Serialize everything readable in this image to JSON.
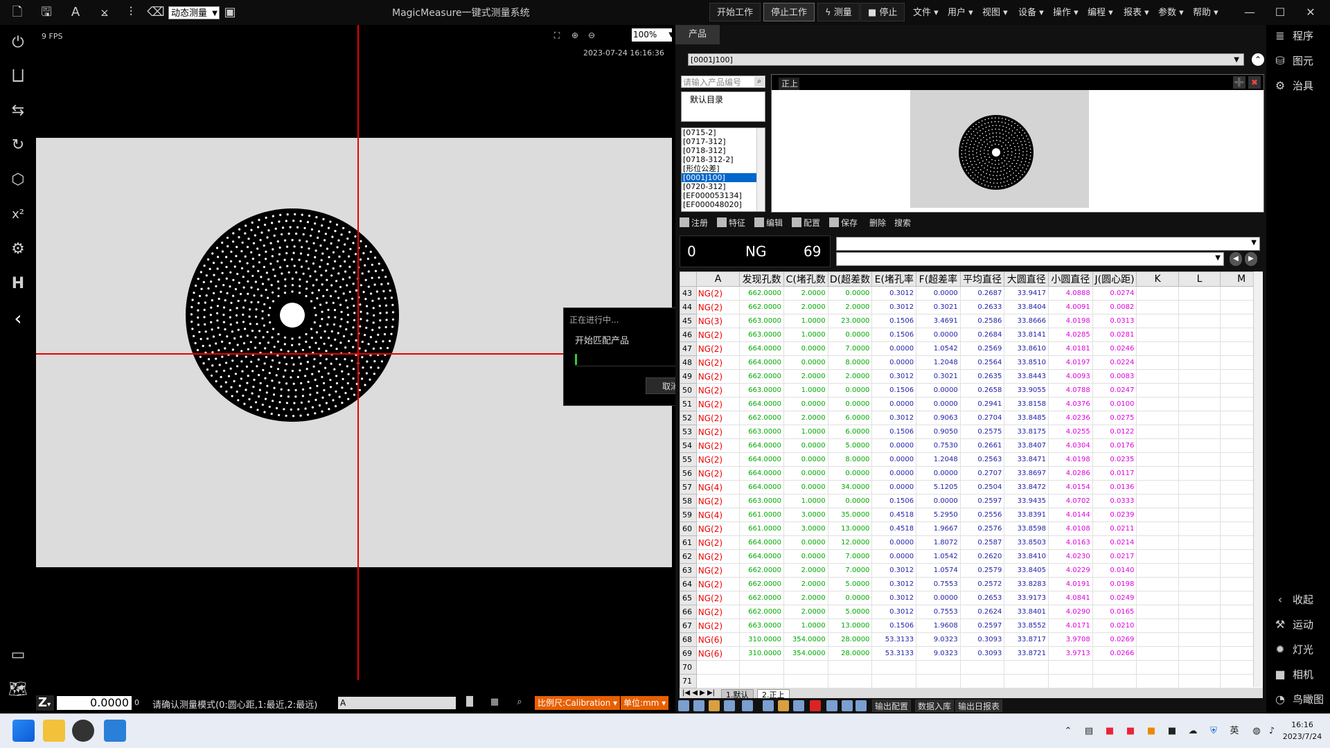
{
  "window": {
    "title": "MagicMeasure一键式测量系统",
    "mode_select": "动态测量"
  },
  "run_buttons": {
    "start": "开始工作",
    "stop_work": "停止工作",
    "measure": "测量",
    "stop": "停止"
  },
  "menu": [
    "文件",
    "用户",
    "视图",
    "设备",
    "操作",
    "编程",
    "报表",
    "参数",
    "帮助"
  ],
  "camera": {
    "fps": "9 FPS",
    "timestamp": "2023-07-24 16:16:36",
    "zoom": "100%"
  },
  "progress_dialog": {
    "title": "正在进行中...",
    "message": "开始匹配产品",
    "cancel": "取消",
    "progress": 0.01
  },
  "statusbar": {
    "z_label": "Z",
    "z_value": "0.0000",
    "z_suffix": "0",
    "prompt": "请确认测量模式(0:圆心距,1:最近,2:最远)",
    "prompt_value": "A",
    "calibration": "比例尺:Calibration",
    "unit": "单位:mm"
  },
  "product": {
    "tab": "产品",
    "selected": "[0001J100]",
    "search_placeholder": "请输入产品编号",
    "default_dir": "默认目录",
    "list": [
      "[0715-2]",
      "[0717-312]",
      "[0718-312]",
      "[0718-312-2]",
      "[形位公差]",
      "[0001J100]",
      "[0720-312]",
      "[EF000053134]",
      "[EF000048020]"
    ],
    "selected_index": 5,
    "view_tab": "正上"
  },
  "feature_toolbar": [
    "注册",
    "特征",
    "编辑",
    "配置",
    "保存",
    "删除",
    "搜索"
  ],
  "result": {
    "count": "0",
    "status": "NG",
    "value": "69"
  },
  "sheet": {
    "headers": [
      "A",
      "发现孔数",
      "C(堵孔数",
      "D(超差数",
      "E(堵孔率",
      "F(超差率",
      "平均直径",
      "大圆直径",
      "小圆直径",
      "J(圆心距)",
      "K",
      "L",
      "M"
    ],
    "rows": [
      [
        "43",
        "NG(2)",
        "662.0000",
        "2.0000",
        "0.0000",
        "0.3012",
        "0.0000",
        "0.2687",
        "33.9417",
        "4.0888",
        "0.0274"
      ],
      [
        "44",
        "NG(2)",
        "662.0000",
        "2.0000",
        "2.0000",
        "0.3012",
        "0.3021",
        "0.2633",
        "33.8404",
        "4.0091",
        "0.0082"
      ],
      [
        "45",
        "NG(3)",
        "663.0000",
        "1.0000",
        "23.0000",
        "0.1506",
        "3.4691",
        "0.2586",
        "33.8666",
        "4.0198",
        "0.0313"
      ],
      [
        "46",
        "NG(2)",
        "663.0000",
        "1.0000",
        "0.0000",
        "0.1506",
        "0.0000",
        "0.2684",
        "33.8141",
        "4.0285",
        "0.0281"
      ],
      [
        "47",
        "NG(2)",
        "664.0000",
        "0.0000",
        "7.0000",
        "0.0000",
        "1.0542",
        "0.2569",
        "33.8610",
        "4.0181",
        "0.0246"
      ],
      [
        "48",
        "NG(2)",
        "664.0000",
        "0.0000",
        "8.0000",
        "0.0000",
        "1.2048",
        "0.2564",
        "33.8510",
        "4.0197",
        "0.0224"
      ],
      [
        "49",
        "NG(2)",
        "662.0000",
        "2.0000",
        "2.0000",
        "0.3012",
        "0.3021",
        "0.2635",
        "33.8443",
        "4.0093",
        "0.0083"
      ],
      [
        "50",
        "NG(2)",
        "663.0000",
        "1.0000",
        "0.0000",
        "0.1506",
        "0.0000",
        "0.2658",
        "33.9055",
        "4.0788",
        "0.0247"
      ],
      [
        "51",
        "NG(2)",
        "664.0000",
        "0.0000",
        "0.0000",
        "0.0000",
        "0.0000",
        "0.2941",
        "33.8158",
        "4.0376",
        "0.0100"
      ],
      [
        "52",
        "NG(2)",
        "662.0000",
        "2.0000",
        "6.0000",
        "0.3012",
        "0.9063",
        "0.2704",
        "33.8485",
        "4.0236",
        "0.0275"
      ],
      [
        "53",
        "NG(2)",
        "663.0000",
        "1.0000",
        "6.0000",
        "0.1506",
        "0.9050",
        "0.2575",
        "33.8175",
        "4.0255",
        "0.0122"
      ],
      [
        "54",
        "NG(2)",
        "664.0000",
        "0.0000",
        "5.0000",
        "0.0000",
        "0.7530",
        "0.2661",
        "33.8407",
        "4.0304",
        "0.0176"
      ],
      [
        "55",
        "NG(2)",
        "664.0000",
        "0.0000",
        "8.0000",
        "0.0000",
        "1.2048",
        "0.2563",
        "33.8471",
        "4.0198",
        "0.0235"
      ],
      [
        "56",
        "NG(2)",
        "664.0000",
        "0.0000",
        "0.0000",
        "0.0000",
        "0.0000",
        "0.2707",
        "33.8697",
        "4.0286",
        "0.0117"
      ],
      [
        "57",
        "NG(4)",
        "664.0000",
        "0.0000",
        "34.0000",
        "0.0000",
        "5.1205",
        "0.2504",
        "33.8472",
        "4.0154",
        "0.0136"
      ],
      [
        "58",
        "NG(2)",
        "663.0000",
        "1.0000",
        "0.0000",
        "0.1506",
        "0.0000",
        "0.2597",
        "33.9435",
        "4.0702",
        "0.0333"
      ],
      [
        "59",
        "NG(4)",
        "661.0000",
        "3.0000",
        "35.0000",
        "0.4518",
        "5.2950",
        "0.2556",
        "33.8391",
        "4.0144",
        "0.0239"
      ],
      [
        "60",
        "NG(2)",
        "661.0000",
        "3.0000",
        "13.0000",
        "0.4518",
        "1.9667",
        "0.2576",
        "33.8598",
        "4.0108",
        "0.0211"
      ],
      [
        "61",
        "NG(2)",
        "664.0000",
        "0.0000",
        "12.0000",
        "0.0000",
        "1.8072",
        "0.2587",
        "33.8503",
        "4.0163",
        "0.0214"
      ],
      [
        "62",
        "NG(2)",
        "664.0000",
        "0.0000",
        "7.0000",
        "0.0000",
        "1.0542",
        "0.2620",
        "33.8410",
        "4.0230",
        "0.0217"
      ],
      [
        "63",
        "NG(2)",
        "662.0000",
        "2.0000",
        "7.0000",
        "0.3012",
        "1.0574",
        "0.2579",
        "33.8405",
        "4.0229",
        "0.0140"
      ],
      [
        "64",
        "NG(2)",
        "662.0000",
        "2.0000",
        "5.0000",
        "0.3012",
        "0.7553",
        "0.2572",
        "33.8283",
        "4.0191",
        "0.0198"
      ],
      [
        "65",
        "NG(2)",
        "662.0000",
        "2.0000",
        "0.0000",
        "0.3012",
        "0.0000",
        "0.2653",
        "33.9173",
        "4.0841",
        "0.0249"
      ],
      [
        "66",
        "NG(2)",
        "662.0000",
        "2.0000",
        "5.0000",
        "0.3012",
        "0.7553",
        "0.2624",
        "33.8401",
        "4.0290",
        "0.0165"
      ],
      [
        "67",
        "NG(2)",
        "663.0000",
        "1.0000",
        "13.0000",
        "0.1506",
        "1.9608",
        "0.2597",
        "33.8552",
        "4.0171",
        "0.0210"
      ],
      [
        "68",
        "NG(6)",
        "310.0000",
        "354.0000",
        "28.0000",
        "53.3133",
        "9.0323",
        "0.3093",
        "33.8717",
        "3.9708",
        "0.0269"
      ],
      [
        "69",
        "NG(6)",
        "310.0000",
        "354.0000",
        "28.0000",
        "53.3133",
        "9.0323",
        "0.3093",
        "33.8721",
        "3.9713",
        "0.0266"
      ],
      [
        "70",
        "",
        "",
        "",
        "",
        "",
        "",
        "",
        "",
        "",
        ""
      ],
      [
        "71",
        "",
        "",
        "",
        "",
        "",
        "",
        "",
        "",
        "",
        ""
      ]
    ],
    "tabs": [
      "1.默认",
      "2.正上"
    ]
  },
  "bottom_buttons": [
    "输出配置",
    "数据入库",
    "输出日报表"
  ],
  "right_sidebar": {
    "top": [
      {
        "icon": "program-icon",
        "label": "程序"
      },
      {
        "icon": "element-icon",
        "label": "图元"
      },
      {
        "icon": "fixture-icon",
        "label": "治具"
      }
    ],
    "bottom": [
      {
        "icon": "collapse-icon",
        "label": "收起"
      },
      {
        "icon": "motion-icon",
        "label": "运动"
      },
      {
        "icon": "light-icon",
        "label": "灯光"
      },
      {
        "icon": "camera-icon",
        "label": "相机"
      },
      {
        "icon": "birdseye-icon",
        "label": "鸟瞰图"
      }
    ]
  },
  "taskbar": {
    "ime": "英",
    "time": "16:16",
    "date": "2023/7/24"
  }
}
